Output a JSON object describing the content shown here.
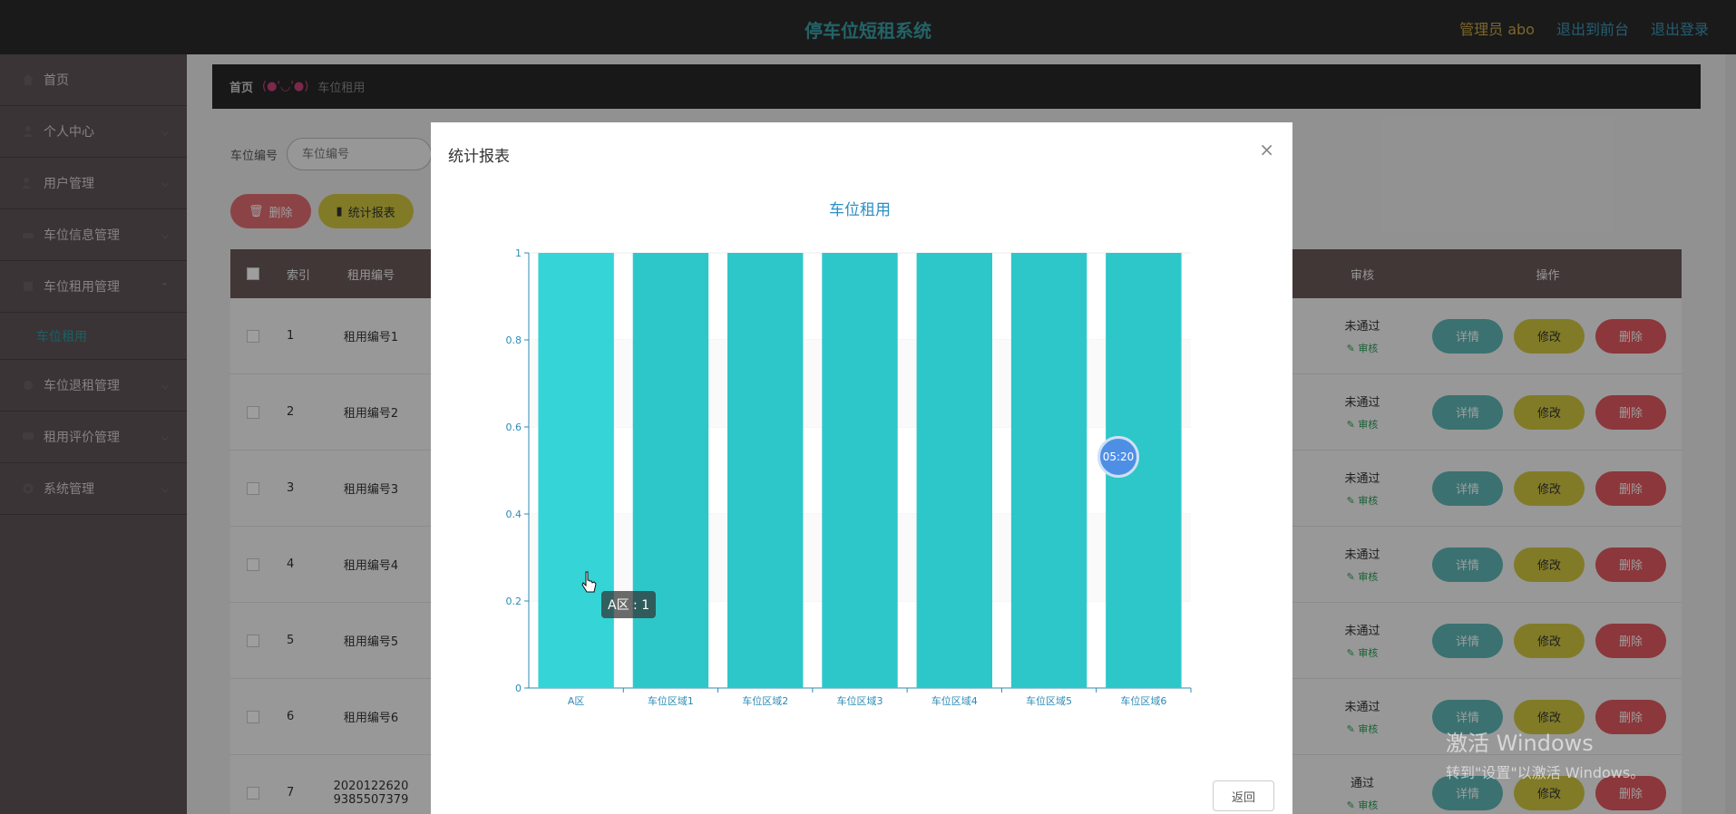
{
  "header": {
    "title": "停车位短租系统",
    "admin": "管理员 abo",
    "to_front": "退出到前台",
    "logout": "退出登录"
  },
  "sidebar": {
    "items": [
      {
        "label": "首页",
        "icon": "home-icon"
      },
      {
        "label": "个人中心",
        "icon": "user-icon"
      },
      {
        "label": "用户管理",
        "icon": "users-icon"
      },
      {
        "label": "车位信息管理",
        "icon": "car-icon"
      },
      {
        "label": "车位租用管理",
        "icon": "rent-icon"
      }
    ],
    "sub_item": "车位租用",
    "items_after": [
      {
        "label": "车位退租管理",
        "icon": "return-icon"
      },
      {
        "label": "租用评价管理",
        "icon": "comment-icon"
      },
      {
        "label": "系统管理",
        "icon": "settings-icon"
      }
    ]
  },
  "breadcrumb": {
    "home": "首页",
    "separator": "(●'◡'●)",
    "current": "车位租用"
  },
  "search": {
    "label": "车位编号",
    "placeholder": "车位编号"
  },
  "buttons": {
    "delete": "删除",
    "report": "统计报表"
  },
  "table": {
    "headers": {
      "index": "索引",
      "code": "租用编号",
      "audit": "审核",
      "ops": "操作"
    },
    "rows": [
      {
        "index": "1",
        "code": "租用编号1",
        "audit": "未通过",
        "action": "审核"
      },
      {
        "index": "2",
        "code": "租用编号2",
        "audit": "未通过",
        "action": "审核"
      },
      {
        "index": "3",
        "code": "租用编号3",
        "audit": "未通过",
        "action": "审核"
      },
      {
        "index": "4",
        "code": "租用编号4",
        "audit": "未通过",
        "action": "审核"
      },
      {
        "index": "5",
        "code": "租用编号5",
        "audit": "未通过",
        "action": "审核"
      },
      {
        "index": "6",
        "code": "租用编号6",
        "audit": "未通过",
        "action": "审核"
      },
      {
        "index": "7",
        "code": "2020122620 9385507379",
        "audit": "通过",
        "action": "审核"
      }
    ],
    "ops": {
      "detail": "详情",
      "edit": "修改",
      "delete": "删除"
    }
  },
  "dialog": {
    "title": "统计报表",
    "back": "返回"
  },
  "chart_data": {
    "type": "bar",
    "title": "车位租用",
    "categories": [
      "A区",
      "车位区域1",
      "车位区域2",
      "车位区域3",
      "车位区域4",
      "车位区域5",
      "车位区域6"
    ],
    "values": [
      1,
      1,
      1,
      1,
      1,
      1,
      1
    ],
    "ylim": [
      0,
      1
    ],
    "yticks": [
      "0",
      "0.2",
      "0.4",
      "0.6",
      "0.8",
      "1"
    ],
    "color": "#2ec7c9",
    "highlight_color": "#35d4d6",
    "tooltip": "A区 : 1"
  },
  "timer": "05:20",
  "watermark": {
    "line1": "激活 Windows",
    "line2": "转到\"设置\"以激活 Windows。"
  }
}
